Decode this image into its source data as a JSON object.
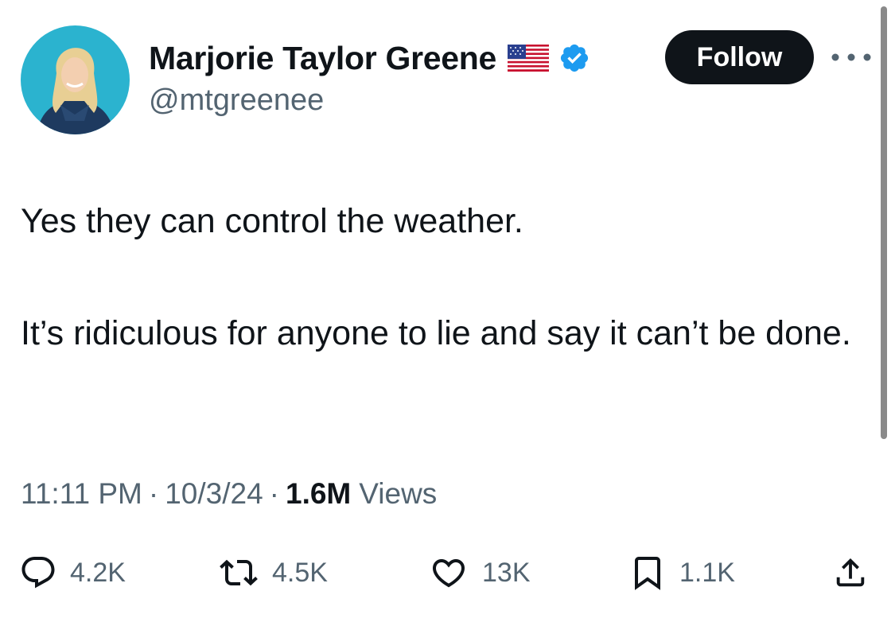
{
  "author": {
    "display_name": "Marjorie Taylor Greene",
    "handle": "@mtgreenee",
    "flag_icon": "us-flag-icon",
    "verified_icon": "verified-badge-icon",
    "verified_color": "#1d9bf0"
  },
  "header": {
    "follow_label": "Follow",
    "more_icon": "more-options-icon"
  },
  "tweet": {
    "paragraphs": [
      "Yes they can control the weather.",
      "It’s ridiculous for anyone to lie and say it can’t be done."
    ]
  },
  "meta": {
    "time": "11:11 PM",
    "separator": "·",
    "date": "10/3/24",
    "views_count": "1.6M",
    "views_label": "Views"
  },
  "actions": {
    "reply_count": "4.2K",
    "retweet_count": "4.5K",
    "like_count": "13K",
    "bookmark_count": "1.1K"
  },
  "colors": {
    "text_primary": "#0f1419",
    "text_secondary": "#536471",
    "follow_bg": "#0f1419",
    "avatar_bg": "#2bb3cf"
  }
}
